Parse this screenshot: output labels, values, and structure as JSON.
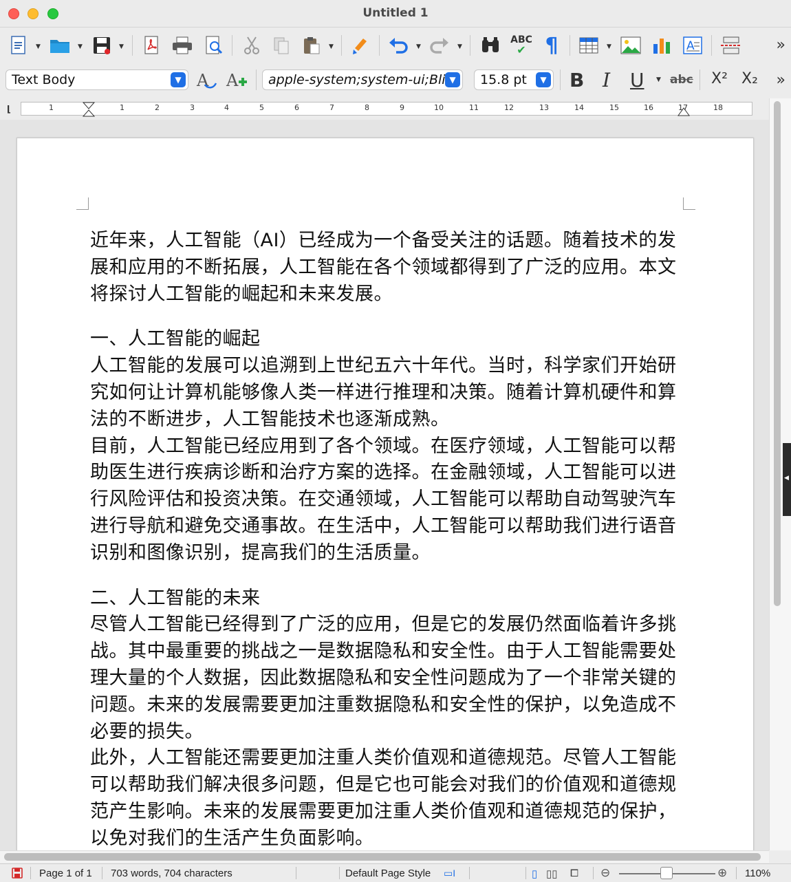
{
  "window": {
    "title": "Untitled 1"
  },
  "toolbar2": {
    "paragraph_style": "Text Body",
    "font_name": "apple-system;system-ui;Blin",
    "font_size": "15.8 pt",
    "bold": "B",
    "italic": "I",
    "underline": "U",
    "strikethrough": "abc",
    "superscript": "X²",
    "subscript": "X₂"
  },
  "toolbar1": {
    "spell_label": "ABC",
    "icons": [
      "new-document-icon",
      "open-folder-icon",
      "save-icon",
      "export-pdf-icon",
      "print-icon",
      "print-preview-icon",
      "cut-icon",
      "copy-icon",
      "paste-icon",
      "clone-formatting-icon",
      "undo-icon",
      "redo-icon",
      "find-replace-icon",
      "spellcheck-icon",
      "formatting-marks-icon",
      "insert-table-icon",
      "insert-image-icon",
      "insert-chart-icon",
      "insert-textbox-icon",
      "insert-page-break-icon"
    ]
  },
  "ruler": {
    "numbers": [
      "1",
      "1",
      "2",
      "3",
      "4",
      "5",
      "6",
      "7",
      "8",
      "9",
      "10",
      "11",
      "12",
      "13",
      "14",
      "15",
      "16",
      "17",
      "18"
    ]
  },
  "document": {
    "paragraphs": [
      "近年来，人工智能（AI）已经成为一个备受关注的话题。随着技术的发展和应用的不断拓展，人工智能在各个领域都得到了广泛的应用。本文将探讨人工智能的崛起和未来发展。",
      "",
      "一、人工智能的崛起",
      "人工智能的发展可以追溯到上世纪五六十年代。当时，科学家们开始研究如何让计算机能够像人类一样进行推理和决策。随着计算机硬件和算法的不断进步，人工智能技术也逐渐成熟。",
      "目前，人工智能已经应用到了各个领域。在医疗领域，人工智能可以帮助医生进行疾病诊断和治疗方案的选择。在金融领域，人工智能可以进行风险评估和投资决策。在交通领域，人工智能可以帮助自动驾驶汽车进行导航和避免交通事故。在生活中，人工智能可以帮助我们进行语音识别和图像识别，提高我们的生活质量。",
      "",
      "二、人工智能的未来",
      "尽管人工智能已经得到了广泛的应用，但是它的发展仍然面临着许多挑战。其中最重要的挑战之一是数据隐私和安全性。由于人工智能需要处理大量的个人数据，因此数据隐私和安全性问题成为了一个非常关键的问题。未来的发展需要更加注重数据隐私和安全性的保护，以免造成不必要的损失。",
      "此外，人工智能还需要更加注重人类价值观和道德规范。尽管人工智能可以帮助我们解决很多问题，但是它也可能会对我们的价值观和道德规范产生影响。未来的发展需要更加注重人类价值观和道德规范的保护，以免对我们的生活产生负面影响。"
    ]
  },
  "statusbar": {
    "page": "Page 1 of 1",
    "word_count": "703 words, 704 characters",
    "page_style": "Default Page Style",
    "zoom": "110%"
  }
}
